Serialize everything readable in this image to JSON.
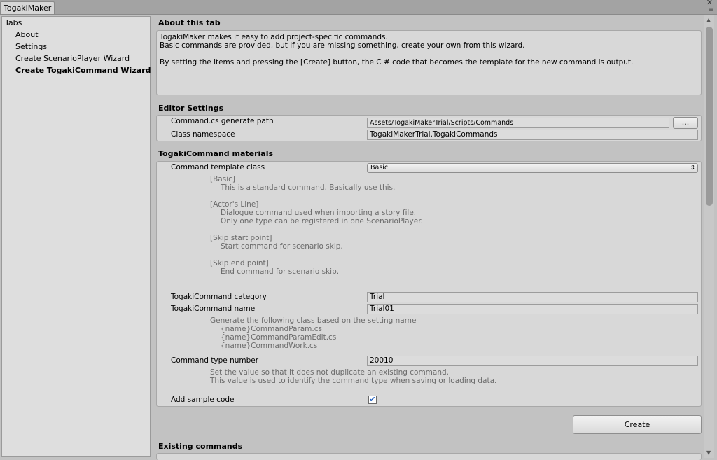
{
  "window": {
    "tab_title": "TogakiMaker",
    "close_glyph": "✕",
    "menu_glyph": "≡"
  },
  "sidebar": {
    "header": "Tabs",
    "items": [
      {
        "label": "About"
      },
      {
        "label": "Settings"
      },
      {
        "label": "Create ScenarioPlayer Wizard"
      },
      {
        "label": "Create TogakiCommand Wizard",
        "selected": true
      }
    ]
  },
  "about": {
    "title": "About this tab",
    "line1": "TogakiMaker makes it easy to add project-specific commands.",
    "line2": "Basic commands are provided, but if you are missing something, create your own from this wizard.",
    "line3": "By setting the items and pressing the [Create] button, the C # code that becomes the template for the new command is output."
  },
  "editor_settings": {
    "title": "Editor Settings",
    "path_label": "Command.cs generate path",
    "path_value": "Assets/TogakiMakerTrial/Scripts/Commands",
    "browse_label": "...",
    "namespace_label": "Class namespace",
    "namespace_value": "TogakiMakerTrial.TogakiCommands"
  },
  "materials": {
    "title": "TogakiCommand materials",
    "template_label": "Command template class",
    "template_value": "Basic",
    "basic_head": "[Basic]",
    "basic_desc": "This is a standard command. Basically use this.",
    "actor_head": "[Actor's Line]",
    "actor_desc1": "Dialogue command used when importing a story file.",
    "actor_desc2": "Only one type can be registered in one ScenarioPlayer.",
    "skipstart_head": "[Skip start point]",
    "skipstart_desc": "Start command for scenario skip.",
    "skipend_head": "[Skip end point]",
    "skipend_desc": "End command for scenario skip.",
    "category_label": "TogakiCommand category",
    "category_value": "Trial",
    "name_label": "TogakiCommand name",
    "name_value": "Trial01",
    "gen_note": "Generate the following class based on the setting name",
    "gen_file1": "{name}CommandParam.cs",
    "gen_file2": "{name}CommandParamEdit.cs",
    "gen_file3": "{name}CommandWork.cs",
    "typenum_label": "Command type number",
    "typenum_value": "20010",
    "typenum_note1": "Set the value so that it does not duplicate an existing command.",
    "typenum_note2": "This value is used to identify the command type when saving or loading data.",
    "sample_label": "Add sample code",
    "sample_checked": true,
    "check_glyph": "✔"
  },
  "create_label": "Create",
  "existing": {
    "title": "Existing commands"
  },
  "dropdown_glyph": "⇕"
}
